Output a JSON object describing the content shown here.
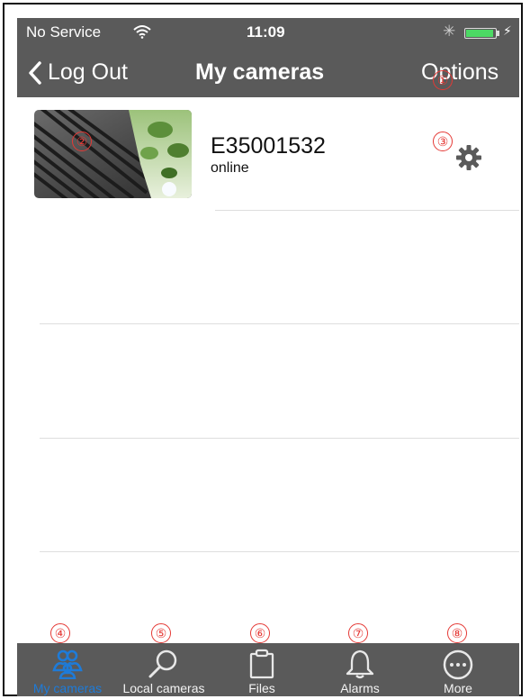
{
  "status_bar": {
    "carrier": "No Service",
    "time": "11:09"
  },
  "nav": {
    "back_label": "Log Out",
    "title": "My cameras",
    "options_label": "Options"
  },
  "cameras": [
    {
      "name": "E35001532",
      "status": "online"
    }
  ],
  "markers": [
    "①",
    "②",
    "③",
    "④",
    "⑤",
    "⑥",
    "⑦",
    "⑧"
  ],
  "tabs": [
    {
      "label": "My cameras",
      "icon": "people-icon",
      "active": true
    },
    {
      "label": "Local cameras",
      "icon": "search-icon",
      "active": false
    },
    {
      "label": "Files",
      "icon": "clipboard-icon",
      "active": false
    },
    {
      "label": "Alarms",
      "icon": "bell-icon",
      "active": false
    },
    {
      "label": "More",
      "icon": "more-icon",
      "active": false
    }
  ],
  "colors": {
    "bar_background": "#5a5a5a",
    "active_tab": "#1e7bd8",
    "annotation": "#e53935",
    "battery": "#4cd964"
  }
}
